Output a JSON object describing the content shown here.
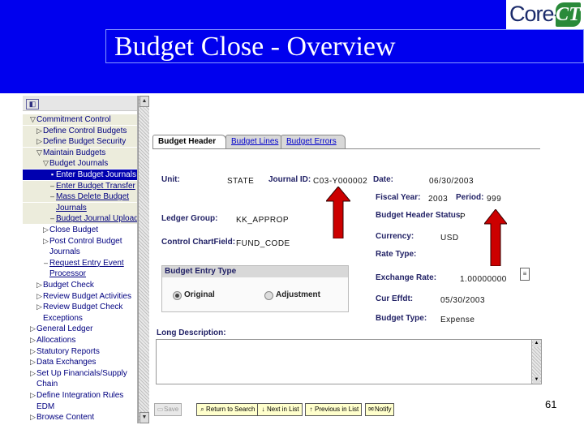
{
  "header": {
    "logo_core": "Core-",
    "logo_ct": "CT",
    "title": "Budget Close - Overview",
    "slide_number": "61"
  },
  "nav": {
    "items": [
      {
        "label": "Commitment Control",
        "glyph": "▽",
        "indent": 0,
        "style": "hl"
      },
      {
        "label": "Define Control Budgets",
        "glyph": "▷",
        "indent": 1,
        "style": "hl"
      },
      {
        "label": "Define Budget Security",
        "glyph": "▷",
        "indent": 1,
        "style": "hl"
      },
      {
        "label": "Maintain Budgets",
        "glyph": "▽",
        "indent": 1,
        "style": "hl"
      },
      {
        "label": "Budget Journals",
        "glyph": "▽",
        "indent": 2,
        "style": "hl"
      },
      {
        "label": "Enter Budget Journals",
        "glyph": "▪",
        "indent": 3,
        "style": "sel"
      },
      {
        "label": "Enter Budget Transfer",
        "glyph": "–",
        "indent": 3,
        "style": "hl link"
      },
      {
        "label": "Mass Delete Budget",
        "glyph": "–",
        "indent": 3,
        "style": "hl link"
      },
      {
        "label": "Journals",
        "glyph": "",
        "indent": 3,
        "style": "hl link"
      },
      {
        "label": "Budget Journal Upload",
        "glyph": "–",
        "indent": 3,
        "style": "hl link"
      },
      {
        "label": "Close Budget",
        "glyph": "▷",
        "indent": 2,
        "style": ""
      },
      {
        "label": "Post Control Budget",
        "glyph": "▷",
        "indent": 2,
        "style": ""
      },
      {
        "label": "Journals",
        "glyph": "",
        "indent": 2,
        "style": ""
      },
      {
        "label": "Request Entry Event",
        "glyph": "–",
        "indent": 2,
        "style": "link"
      },
      {
        "label": "Processor",
        "glyph": "",
        "indent": 2,
        "style": "link"
      },
      {
        "label": "Budget Check",
        "glyph": "▷",
        "indent": 1,
        "style": ""
      },
      {
        "label": "Review Budget Activities",
        "glyph": "▷",
        "indent": 1,
        "style": ""
      },
      {
        "label": "Review Budget Check",
        "glyph": "▷",
        "indent": 1,
        "style": ""
      },
      {
        "label": "Exceptions",
        "glyph": "",
        "indent": 1,
        "style": ""
      },
      {
        "label": "General Ledger",
        "glyph": "▷",
        "indent": 0,
        "style": ""
      },
      {
        "label": "Allocations",
        "glyph": "▷",
        "indent": 0,
        "style": ""
      },
      {
        "label": "Statutory Reports",
        "glyph": "▷",
        "indent": 0,
        "style": ""
      },
      {
        "label": "Data Exchanges",
        "glyph": "▷",
        "indent": 0,
        "style": ""
      },
      {
        "label": "Set Up Financials/Supply",
        "glyph": "▷",
        "indent": 0,
        "style": ""
      },
      {
        "label": "Chain",
        "glyph": "",
        "indent": 0,
        "style": ""
      },
      {
        "label": "Define Integration Rules",
        "glyph": "▷",
        "indent": 0,
        "style": ""
      },
      {
        "label": "EDM",
        "glyph": "",
        "indent": 0,
        "style": ""
      },
      {
        "label": "Browse Content",
        "glyph": "▷",
        "indent": 0,
        "style": ""
      }
    ]
  },
  "tabs": [
    {
      "label": "Budget Header",
      "active": true
    },
    {
      "label": "Budget Lines",
      "active": false
    },
    {
      "label": "Budget Errors",
      "active": false
    }
  ],
  "form": {
    "unit_label": "Unit:",
    "unit_value": "STATE",
    "journal_id_label": "Journal ID:",
    "journal_id_value": "C03-Y000002",
    "date_label": "Date:",
    "date_value": "06/30/2003",
    "fiscal_year_label": "Fiscal Year:",
    "fiscal_year_value": "2003",
    "period_label": "Period:",
    "period_value": "999",
    "ledger_group_label": "Ledger Group:",
    "ledger_group_value": "KK_APPROP",
    "header_status_label": "Budget Header Status:",
    "header_status_value": "P",
    "control_chartfield_label": "Control ChartField:",
    "control_chartfield_value": "FUND_CODE",
    "currency_label": "Currency:",
    "currency_value": "USD",
    "rate_type_label": "Rate Type:",
    "exchange_rate_label": "Exchange Rate:",
    "exchange_rate_value": "1.00000000",
    "cur_effdt_label": "Cur Effdt:",
    "cur_effdt_value": "05/30/2003",
    "budget_type_label": "Budget Type:",
    "budget_type_value": "Expense",
    "entry_type_title": "Budget Entry Type",
    "entry_type_original": "Original",
    "entry_type_adjustment": "Adjustment",
    "entry_type_selected": "Original",
    "long_description_label": "Long Description:"
  },
  "toolbar": {
    "save": "Save",
    "return_to_search": "Return to Search",
    "next_in_list": "Next in List",
    "previous_in_list": "Previous in List",
    "notify": "Notify"
  },
  "colors": {
    "header_blue": "#0000ee",
    "arrow_red": "#cc0000",
    "nav_selected": "#0000b0",
    "ct_green": "#2a8a3a"
  }
}
